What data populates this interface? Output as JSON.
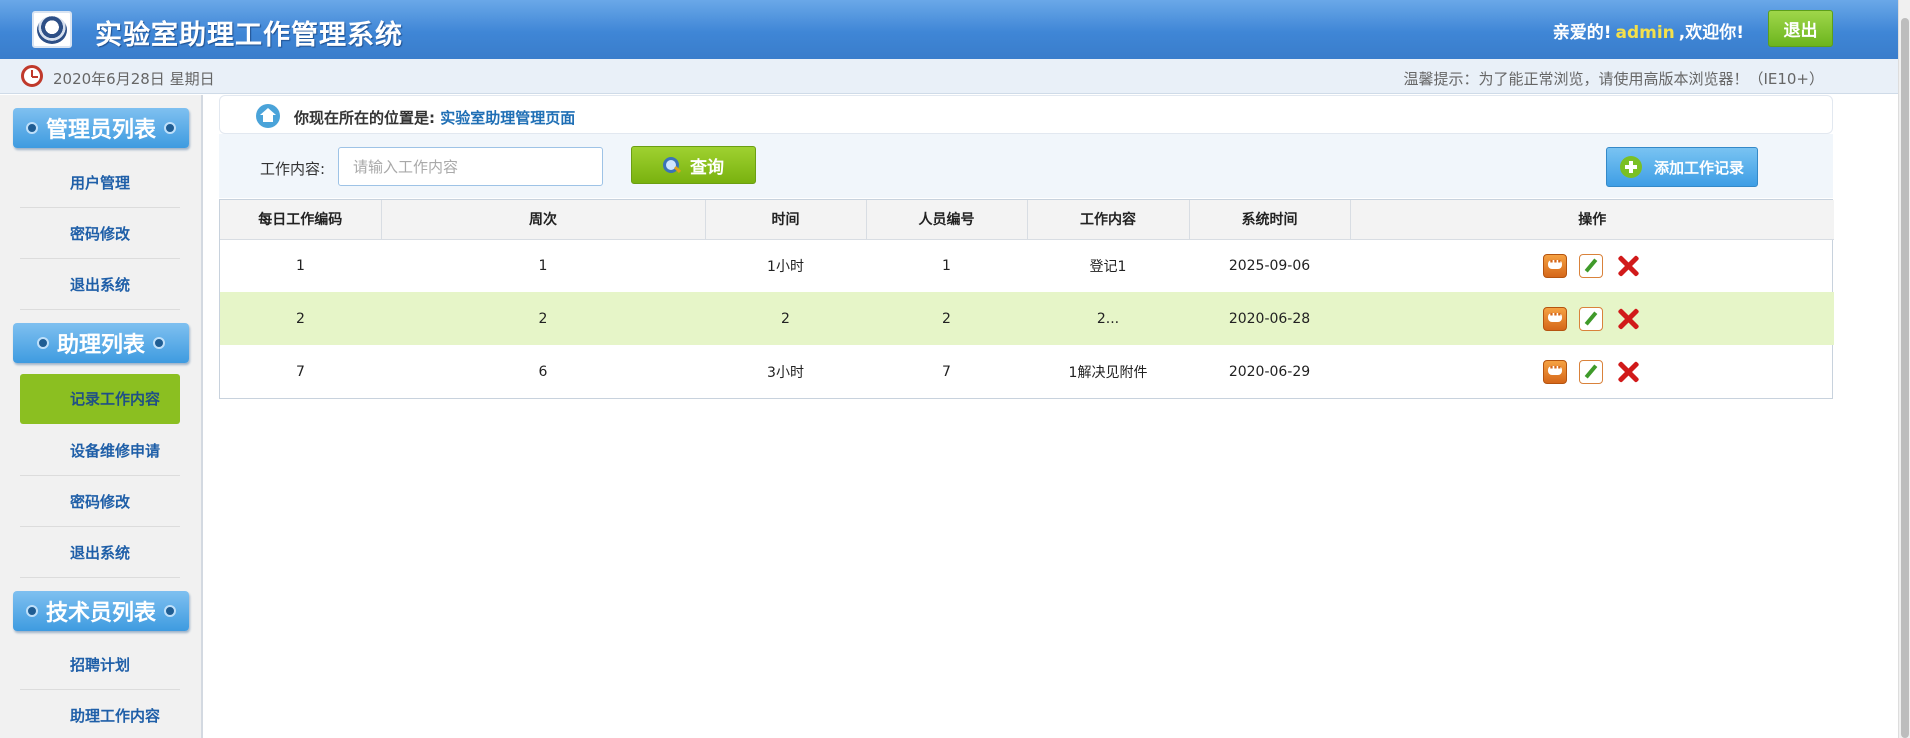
{
  "header": {
    "title": "实验室助理工作管理系统",
    "greet_prefix": "亲爱的!",
    "username": "admin",
    "greet_suffix": ",欢迎你!",
    "logout_label": "退出"
  },
  "datebar": {
    "date": "2020年6月28日 星期日",
    "tip": "温馨提示：为了能正常浏览，请使用高版本浏览器！（IE10+）"
  },
  "sidebar": {
    "sections": [
      {
        "title": "管理员列表",
        "items": [
          "用户管理",
          "密码修改",
          "退出系统"
        ]
      },
      {
        "title": "助理列表",
        "items": [
          "记录工作内容",
          "设备维修申请",
          "密码修改",
          "退出系统"
        ]
      },
      {
        "title": "技术员列表",
        "items": [
          "招聘计划",
          "助理工作内容"
        ]
      }
    ],
    "active_item": "记录工作内容"
  },
  "breadcrumb": {
    "label": "你现在所在的位置是:",
    "current": "实验室助理管理页面"
  },
  "toolbar": {
    "search_label": "工作内容:",
    "search_placeholder": "请输入工作内容",
    "search_value": "",
    "query_label": "查询",
    "add_label": "添加工作记录"
  },
  "table": {
    "headers": [
      "每日工作编码",
      "周次",
      "时间",
      "人员编号",
      "工作内容",
      "系统时间",
      "操作"
    ],
    "rows": [
      [
        "1",
        "1",
        "1小时",
        "1",
        "登记1",
        "2025-09-06"
      ],
      [
        "2",
        "2",
        "2",
        "2",
        "2...",
        "2020-06-28"
      ],
      [
        "7",
        "6",
        "3小时",
        "7",
        "1解决见附件",
        "2020-06-29"
      ]
    ]
  },
  "icons": {
    "logo": "university-seal-icon",
    "clock": "clock-icon",
    "home": "home-icon",
    "search": "magnifier-icon",
    "add": "plus-circle-icon",
    "view": "comment-icon",
    "edit": "pencil-icon",
    "delete": "red-x-icon"
  },
  "colors": {
    "header_blue": "#3f86d6",
    "accent_green": "#8bbf21",
    "link_blue": "#1f6fb5",
    "row_highlight": "#e6f5c8",
    "username_yellow": "#f4e04a"
  }
}
